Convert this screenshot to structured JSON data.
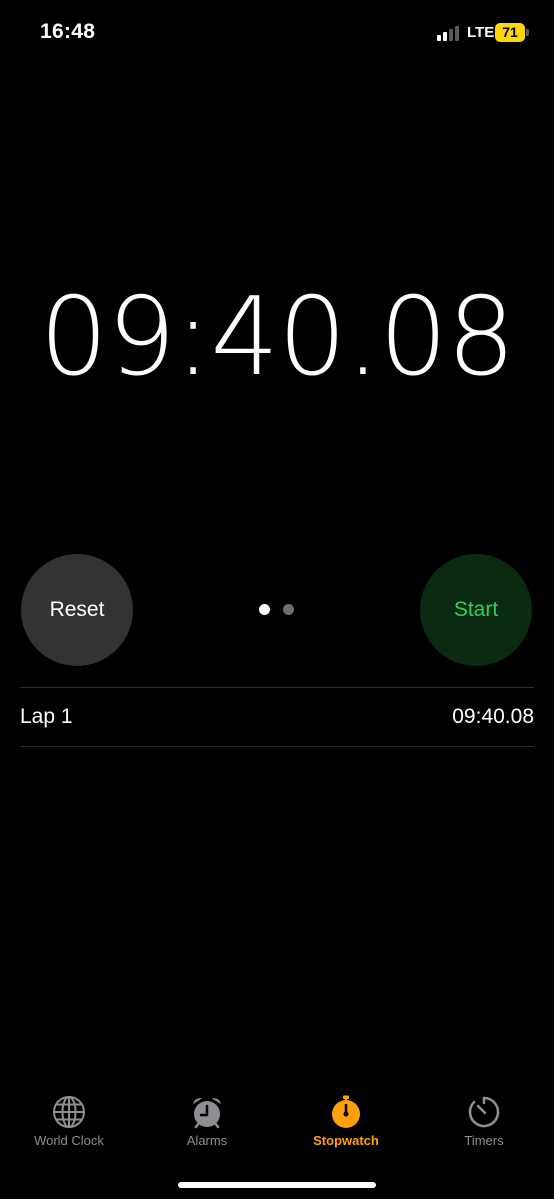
{
  "status_bar": {
    "time": "16:48",
    "network": "LTE",
    "battery_level": "71",
    "battery_color": "#ffd60a"
  },
  "stopwatch": {
    "display": "09:40.08",
    "reset_label": "Reset",
    "start_label": "Start",
    "start_color": "#30d158",
    "page_count": 2,
    "active_page": 1
  },
  "laps": [
    {
      "label": "Lap 1",
      "time": "09:40.08"
    }
  ],
  "tabs": [
    {
      "label": "World Clock",
      "icon": "globe-icon",
      "active": false
    },
    {
      "label": "Alarms",
      "icon": "alarm-clock-icon",
      "active": false
    },
    {
      "label": "Stopwatch",
      "icon": "stopwatch-icon",
      "active": true
    },
    {
      "label": "Timers",
      "icon": "timer-icon",
      "active": false
    }
  ],
  "colors": {
    "accent": "#ff9f0a",
    "inactive_tab": "#8e8e93"
  }
}
